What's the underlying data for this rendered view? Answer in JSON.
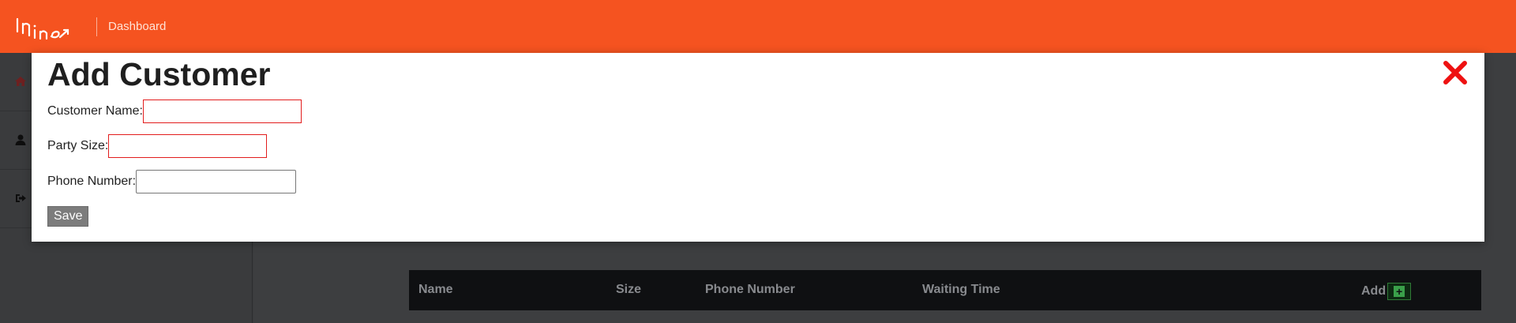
{
  "topbar": {
    "logo_text": "Inine",
    "breadcrumb": "Dashboard",
    "background_color": "#f55320"
  },
  "sidebar": {
    "items": [
      {
        "icon": "home-icon"
      },
      {
        "icon": "user-icon"
      },
      {
        "icon": "sign-out-icon"
      }
    ]
  },
  "table": {
    "columns": [
      "Name",
      "Size",
      "Phone Number",
      "Waiting Time",
      "Add"
    ],
    "add_icon": "plus-square-icon"
  },
  "modal": {
    "title": "Add Customer",
    "close_icon": "close-icon",
    "fields": {
      "customer_name": {
        "label": "Customer Name:",
        "value": ""
      },
      "party_size": {
        "label": "Party Size:",
        "value": ""
      },
      "phone_number": {
        "label": "Phone Number:",
        "value": ""
      }
    },
    "save_label": "Save",
    "invalid_border_color": "#e21d1d"
  }
}
